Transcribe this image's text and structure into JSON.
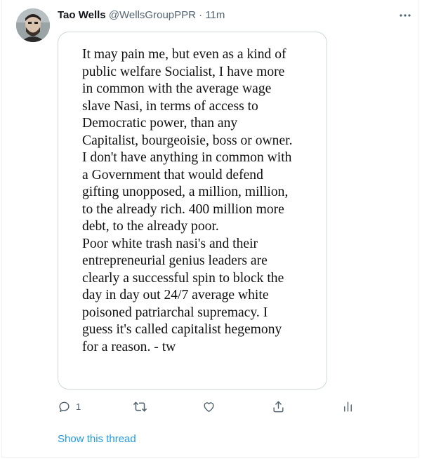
{
  "tweet": {
    "author_name": "Tao Wells",
    "handle": "@WellsGroupPPR",
    "separator": "·",
    "time": "11m",
    "image_text": "It may pain me, but even as a kind of\npublic welfare Socialist, I have more\nin common with the average wage\nslave Nasi, in terms of access to\nDemocratic power, than any\nCapitalist, bourgeoisie, boss or owner.\nI don't have anything in common with\na Government that would defend\ngifting unopposed, a million, million,\nto the already rich. 400 million more\ndebt, to the already poor.\nPoor white trash nasi's and their\nentrepreneurial genius leaders are\nclearly a successful spin to block the\nday in day out 24/7 average white\npoisoned patriarchal supremacy. I\nguess it's called capitalist hegemony\nfor a reason.  - tw",
    "reply_count": "1",
    "show_thread_label": "Show this thread"
  },
  "icons": {
    "more": "more-dots-icon",
    "reply": "reply-bubble-icon",
    "retweet": "retweet-icon",
    "like": "heart-icon",
    "share": "share-upload-icon",
    "analytics": "analytics-bars-icon"
  },
  "colors": {
    "link": "#1d9bf0",
    "secondary_text": "#536471",
    "border": "#cfd9de"
  }
}
